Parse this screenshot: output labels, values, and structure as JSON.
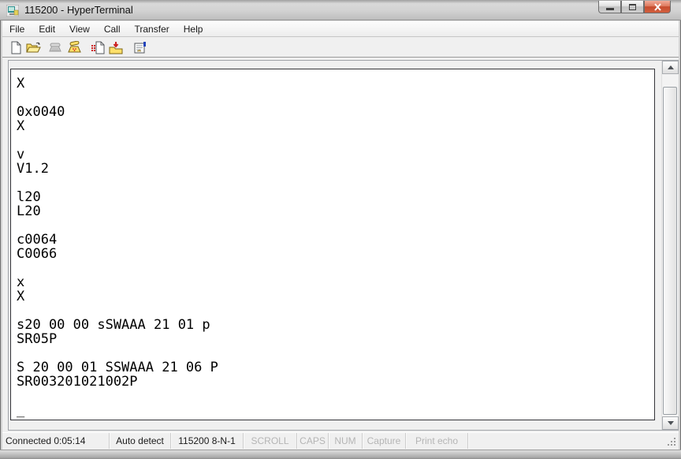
{
  "window": {
    "title": "115200 - HyperTerminal",
    "controls": {
      "minimize": "minimize",
      "maximize": "maximize",
      "close": "close"
    }
  },
  "menu_bar": {
    "items": [
      {
        "label": "File"
      },
      {
        "label": "Edit"
      },
      {
        "label": "View"
      },
      {
        "label": "Call"
      },
      {
        "label": "Transfer"
      },
      {
        "label": "Help"
      }
    ]
  },
  "toolbar": {
    "buttons": [
      {
        "name": "new-connection",
        "enabled": true
      },
      {
        "name": "open",
        "enabled": true
      },
      {
        "name": "call",
        "enabled": false
      },
      {
        "name": "disconnect",
        "enabled": true
      },
      {
        "name": "send-file",
        "enabled": true
      },
      {
        "name": "receive-file",
        "enabled": true
      },
      {
        "name": "properties",
        "enabled": true
      }
    ]
  },
  "terminal": {
    "lines": [
      "X",
      "",
      "0x0040",
      "X",
      "",
      "v",
      "V1.2",
      "",
      "l20",
      "L20",
      "",
      "c0064",
      "C0066",
      "",
      "x",
      "X",
      "",
      "s20 00 00 sSWAAA 21 01 p",
      "SR05P",
      "",
      "S 20 00 01 SSWAAA 21 06 P",
      "SR003201021002P",
      "",
      "_"
    ],
    "cursor": "_"
  },
  "status_bar": {
    "panels": [
      {
        "label": "Connected 0:05:14",
        "enabled": true
      },
      {
        "label": "Auto detect",
        "enabled": true
      },
      {
        "label": "115200 8-N-1",
        "enabled": true
      },
      {
        "label": "SCROLL",
        "enabled": false
      },
      {
        "label": "CAPS",
        "enabled": false
      },
      {
        "label": "NUM",
        "enabled": false
      },
      {
        "label": "Capture",
        "enabled": false
      },
      {
        "label": "Print echo",
        "enabled": false
      }
    ]
  },
  "colors": {
    "terminal_bg": "#ffffff",
    "terminal_fg": "#000000",
    "close_button": "#c64b2d",
    "chrome_bg": "#f0f0f0",
    "folder_yellow": "#ffe06a"
  }
}
